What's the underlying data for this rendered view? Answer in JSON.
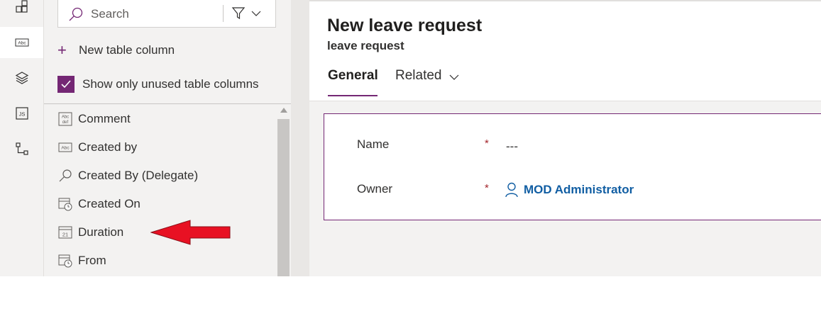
{
  "pane": {
    "search_placeholder": "Search",
    "new_column_label": "New table column",
    "show_unused_label": "Show only unused table columns",
    "show_unused_checked": true,
    "fields": [
      {
        "label": "Comment",
        "icon": "multiline-text-icon"
      },
      {
        "label": "Created by",
        "icon": "text-icon"
      },
      {
        "label": "Created By (Delegate)",
        "icon": "lookup-icon"
      },
      {
        "label": "Created On",
        "icon": "datetime-icon"
      },
      {
        "label": "Duration",
        "icon": "calendar-icon"
      },
      {
        "label": "From",
        "icon": "datetime-icon"
      }
    ]
  },
  "form": {
    "title": "New leave request",
    "subtitle": "leave request",
    "tabs": [
      {
        "label": "General",
        "selected": true
      },
      {
        "label": "Related",
        "selected": false
      }
    ],
    "fields": [
      {
        "label": "Name",
        "required_mark": "*",
        "value": "---"
      },
      {
        "label": "Owner",
        "required_mark": "*",
        "value": "MOD Administrator"
      }
    ]
  },
  "colors": {
    "accent": "#742774",
    "link": "#115ea3",
    "required": "#a4262c",
    "annotation_arrow": "#e81123"
  }
}
